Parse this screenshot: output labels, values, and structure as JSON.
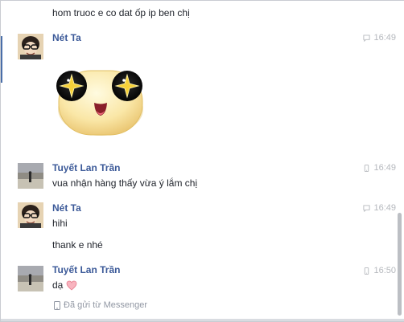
{
  "conversation": {
    "messages": [
      {
        "text": "hom truoc e co dat ốp ip ben chị"
      },
      {
        "sender": "Nét Ta",
        "time": "16:49"
      },
      {
        "sender": "Tuyết Lan Trần",
        "time": "16:49",
        "text": "vua nhận hàng thấy vừa ý lắm chị"
      },
      {
        "sender": "Nét Ta",
        "time": "16:49",
        "text": "hihi",
        "text2": "thank e nhé"
      },
      {
        "sender": "Tuyết Lan Trần",
        "time": "16:50",
        "text": "dạ"
      }
    ],
    "sent_via": "Đã gửi từ Messenger"
  },
  "icons": {
    "chat_time": "speech-bubble-icon",
    "mobile_time": "mobile-phone-icon",
    "heart": "heart-icon",
    "sticker": "star-eyes-sticker"
  },
  "colors": {
    "sender_name": "#3b5998",
    "timestamp": "#b5b8bd",
    "heart": "#f38b9b"
  }
}
